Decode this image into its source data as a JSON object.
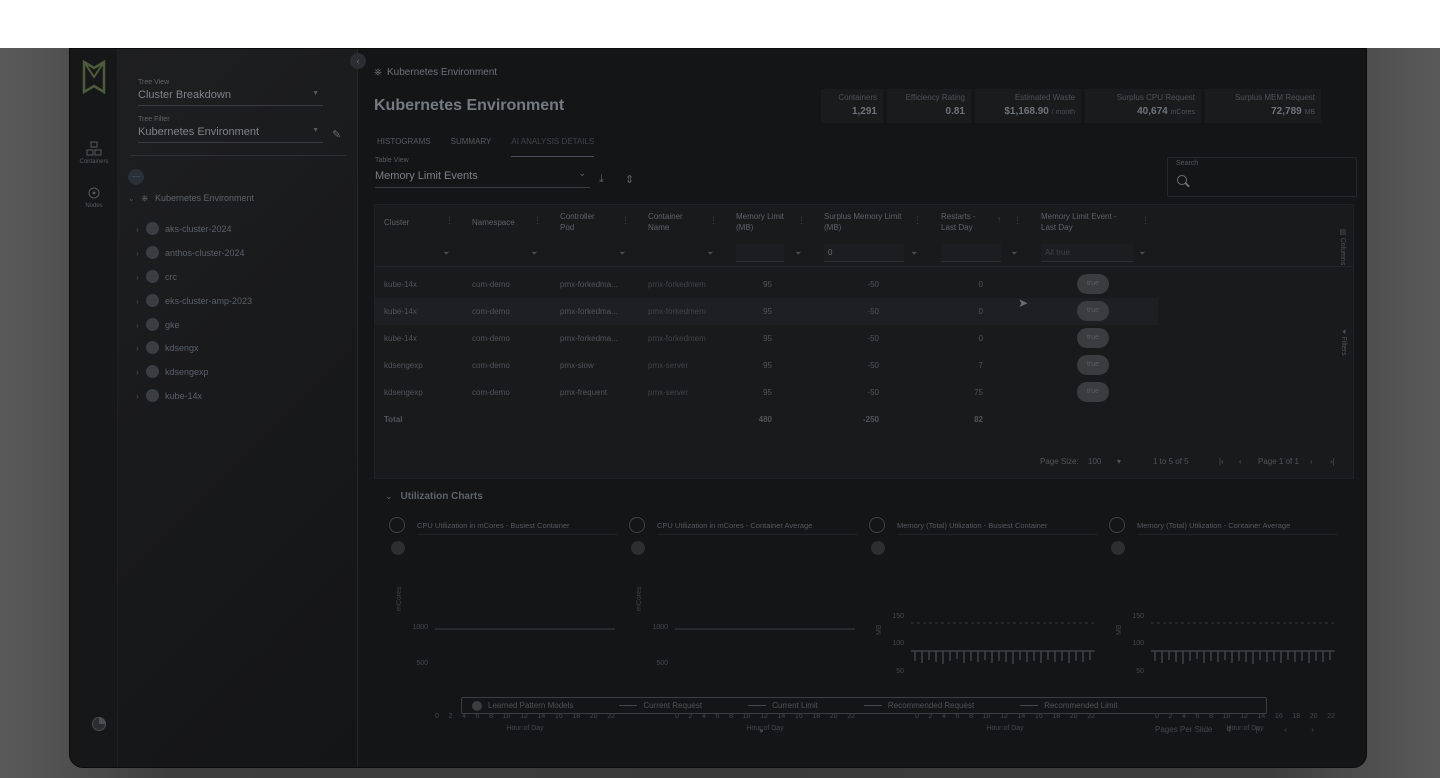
{
  "rail": {
    "items": [
      {
        "label": "Containers",
        "icon": "containers-icon"
      },
      {
        "label": "Nodes",
        "icon": "nodes-icon"
      }
    ]
  },
  "tree_panel": {
    "tree_view": {
      "label": "Tree View",
      "value": "Cluster Breakdown"
    },
    "tree_filter": {
      "label": "Tree Filter",
      "value": "Kubernetes Environment"
    },
    "root": "Kubernetes Environment",
    "clusters": [
      "aks-cluster-2024",
      "anthos-cluster-2024",
      "crc",
      "eks-cluster-amp-2023",
      "gke",
      "kdsengx",
      "kdsengexp",
      "kube-14x"
    ]
  },
  "main": {
    "breadcrumb": "Kubernetes Environment",
    "title": "Kubernetes Environment",
    "stats": [
      {
        "label": "Containers",
        "value": "1,291",
        "unit": ""
      },
      {
        "label": "Efficiency Rating",
        "value": "0.81",
        "unit": ""
      },
      {
        "label": "Estimated Waste",
        "value": "$1,168.90",
        "unit": "/ month"
      },
      {
        "label": "Surplus CPU Request",
        "value": "40,674",
        "unit": "mCores"
      },
      {
        "label": "Surplus MEM Request",
        "value": "72,789",
        "unit": "MB"
      }
    ],
    "tabs": [
      "HISTOGRAMS",
      "SUMMARY",
      "AI ANALYSIS DETAILS"
    ],
    "active_tab": "AI ANALYSIS DETAILS",
    "table_view": {
      "label": "Table View",
      "value": "Memory Limit Events"
    },
    "search": {
      "label": "Search",
      "placeholder": ""
    }
  },
  "grid": {
    "columns": [
      "Cluster",
      "Namespace",
      "Controller Pod",
      "Container Name",
      "Memory Limit (MB)",
      "Surplus Memory Limit (MB)",
      "Restarts - Last Day",
      "Memory Limit Event - Last Day"
    ],
    "surplus_filter_value": "0",
    "event_filter_placeholder": "All true",
    "rows": [
      {
        "cluster": "kube-14x",
        "namespace": "com-demo",
        "pod": "pmx-forkedma...",
        "container": "pmx-forkedmem",
        "mem_limit": "95",
        "surplus": "-50",
        "restarts": "0",
        "event": "true"
      },
      {
        "cluster": "kube-14x",
        "namespace": "com-demo",
        "pod": "pmx-forkedma...",
        "container": "pmx-forkedmem",
        "mem_limit": "95",
        "surplus": "-50",
        "restarts": "0",
        "event": "true"
      },
      {
        "cluster": "kube-14x",
        "namespace": "com-demo",
        "pod": "pmx-forkedma...",
        "container": "pmx-forkedmem",
        "mem_limit": "95",
        "surplus": "-50",
        "restarts": "0",
        "event": "true"
      },
      {
        "cluster": "kdsengexp",
        "namespace": "com-demo",
        "pod": "pmx-slow",
        "container": "pmx-server",
        "mem_limit": "95",
        "surplus": "-50",
        "restarts": "7",
        "event": "true"
      },
      {
        "cluster": "kdsengexp",
        "namespace": "com-demo",
        "pod": "pmx-frequent",
        "container": "pmx-server",
        "mem_limit": "95",
        "surplus": "-50",
        "restarts": "75",
        "event": "true"
      }
    ],
    "total": {
      "label": "Total",
      "mem_limit": "480",
      "surplus": "-250",
      "restarts": "82"
    },
    "side_tabs": [
      "Columns",
      "Filters"
    ],
    "pager": {
      "page_size_label": "Page Size:",
      "page_size": "100",
      "range": "1 to 5 of 5",
      "page": "Page 1 of 1"
    }
  },
  "charts": {
    "section_title": "Utilization Charts",
    "panels": [
      {
        "title": "CPU Utilization in mCores - Busiest Container",
        "ylabel": "mCores",
        "xlabel": "Hour of Day",
        "yticks": [
          "1000",
          "500",
          "0"
        ]
      },
      {
        "title": "CPU Utilization in mCores - Container Average",
        "ylabel": "mCores",
        "xlabel": "Hour of Day",
        "yticks": [
          "1000",
          "500",
          "0"
        ]
      },
      {
        "title": "Memory (Total) Utilization - Busiest Container",
        "ylabel": "MB",
        "xlabel": "Hour of Day",
        "yticks": [
          "150",
          "100",
          "50",
          "0"
        ]
      },
      {
        "title": "Memory (Total) Utilization - Container Average",
        "ylabel": "MB",
        "xlabel": "Hour of Day",
        "yticks": [
          "150",
          "100",
          "50",
          "0"
        ]
      }
    ],
    "xticks": [
      "0",
      "2",
      "4",
      "6",
      "8",
      "10",
      "12",
      "14",
      "16",
      "18",
      "20",
      "22"
    ],
    "legend": [
      "Learned Pattern Models",
      "Current Request",
      "Current Limit",
      "Recommended Request",
      "Recommended Limit"
    ],
    "pages_per_slide_label": "Pages Per Slide",
    "pages_per_slide": "4"
  }
}
